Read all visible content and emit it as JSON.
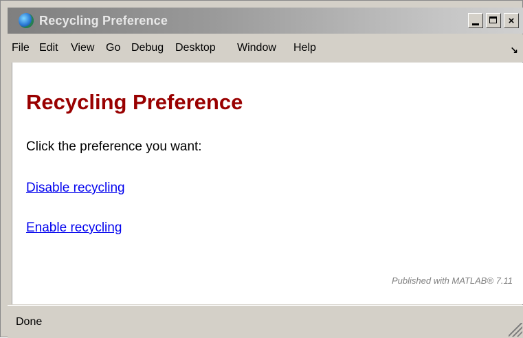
{
  "window": {
    "title": "Recycling Preference",
    "controls": {
      "minimize": "_",
      "maximize": "□",
      "close": "×"
    }
  },
  "menubar": {
    "items": [
      "File",
      "Edit",
      "View",
      "Go",
      "Debug",
      "Desktop",
      "Window",
      "Help"
    ],
    "undock_icon": "↘"
  },
  "page": {
    "title": "Recycling Preference",
    "instruction": "Click the preference you want:",
    "links": {
      "disable": "Disable recycling",
      "enable": "Enable recycling"
    },
    "footer": "Published with MATLAB® 7.11"
  },
  "status": {
    "text": "Done"
  },
  "colors": {
    "title_accent": "#990000",
    "link": "#0000ee",
    "chrome": "#d4d0c8"
  }
}
